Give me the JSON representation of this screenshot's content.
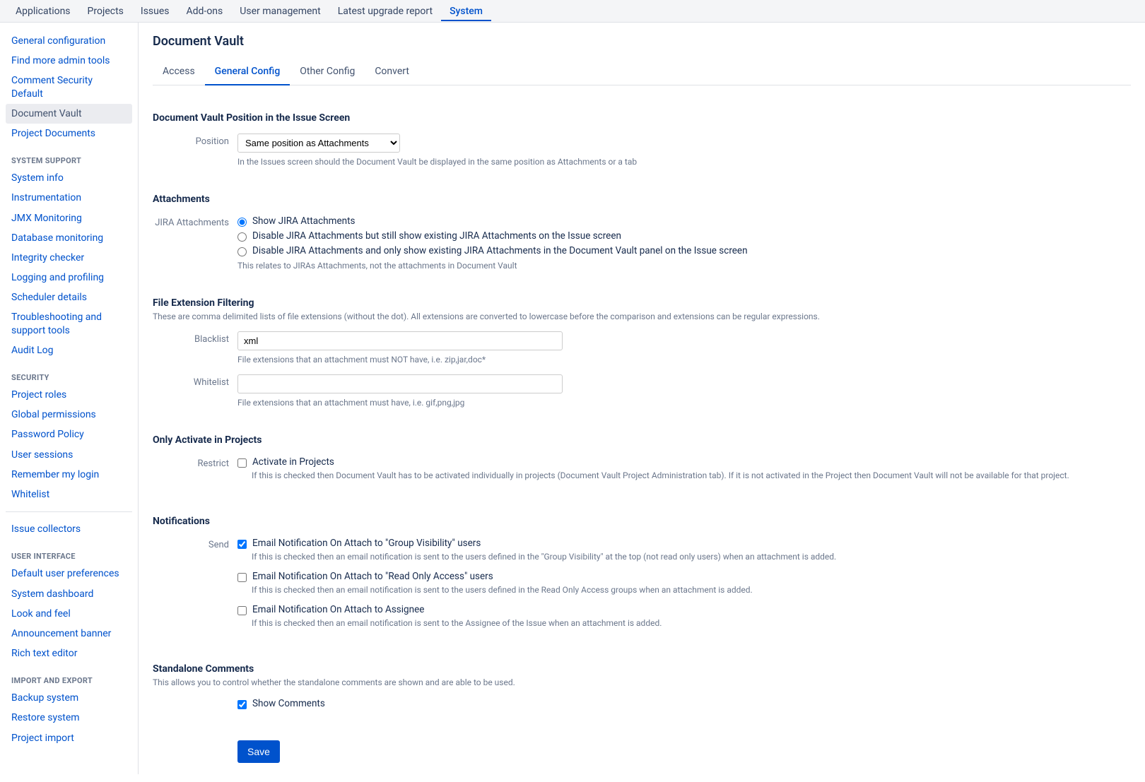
{
  "topnav": [
    {
      "label": "Applications",
      "active": false
    },
    {
      "label": "Projects",
      "active": false
    },
    {
      "label": "Issues",
      "active": false
    },
    {
      "label": "Add-ons",
      "active": false
    },
    {
      "label": "User management",
      "active": false
    },
    {
      "label": "Latest upgrade report",
      "active": false
    },
    {
      "label": "System",
      "active": true
    }
  ],
  "sidebar": {
    "group_top": [
      "General configuration",
      "Find more admin tools",
      "Comment Security Default",
      "Document Vault",
      "Project Documents"
    ],
    "selected": "Document Vault",
    "group_system_support_heading": "System Support",
    "group_system_support": [
      "System info",
      "Instrumentation",
      "JMX Monitoring",
      "Database monitoring",
      "Integrity checker",
      "Logging and profiling",
      "Scheduler details",
      "Troubleshooting and support tools",
      "Audit Log"
    ],
    "group_security_heading": "Security",
    "group_security": [
      "Project roles",
      "Global permissions",
      "Password Policy",
      "User sessions",
      "Remember my login",
      "Whitelist"
    ],
    "group_issue_collectors": [
      "Issue collectors"
    ],
    "group_ui_heading": "User Interface",
    "group_ui": [
      "Default user preferences",
      "System dashboard",
      "Look and feel",
      "Announcement banner",
      "Rich text editor"
    ],
    "group_import_heading": "Import and Export",
    "group_import": [
      "Backup system",
      "Restore system",
      "Project import"
    ]
  },
  "page": {
    "title": "Document Vault",
    "tabs": [
      "Access",
      "General Config",
      "Other Config",
      "Convert"
    ],
    "active_tab": "General Config"
  },
  "position_section": {
    "title": "Document Vault Position in the Issue Screen",
    "label": "Position",
    "selected": "Same position as Attachments",
    "help": "In the Issues screen should the Document Vault be displayed in the same position as Attachments or a tab"
  },
  "attachments_section": {
    "title": "Attachments",
    "label": "JIRA Attachments",
    "options": [
      "Show JIRA Attachments",
      "Disable JIRA Attachments but still show existing JIRA Attachments on the Issue screen",
      "Disable JIRA Attachments and only show existing JIRA Attachments in the Document Vault panel on the Issue screen"
    ],
    "selected_index": 0,
    "help": "This relates to JIRAs Attachments, not the attachments in Document Vault"
  },
  "filter_section": {
    "title": "File Extension Filtering",
    "desc": "These are comma delimited lists of file extensions (without the dot). All extensions are converted to lowercase before the comparison and extensions can be regular expressions.",
    "blacklist_label": "Blacklist",
    "blacklist_value": "xml",
    "blacklist_help": "File extensions that an attachment must NOT have, i.e. zip,jar,doc*",
    "whitelist_label": "Whitelist",
    "whitelist_value": "",
    "whitelist_help": "File extensions that an attachment must have, i.e. gif,png,jpg"
  },
  "activate_section": {
    "title": "Only Activate in Projects",
    "label": "Restrict",
    "option": "Activate in Projects",
    "checked": false,
    "help": "If this is checked then Document Vault has to be activated individually in projects (Document Vault Project Administration tab). If it is not activated in the Project then Document Vault will not be available for that project."
  },
  "notifications_section": {
    "title": "Notifications",
    "label": "Send",
    "options": [
      {
        "label": "Email Notification On Attach to \"Group Visibility\" users",
        "checked": true,
        "help": "If this is checked then an email notification is sent to the users defined in the \"Group Visibility\" at the top (not read only users) when an attachment is added."
      },
      {
        "label": "Email Notification On Attach to \"Read Only Access\" users",
        "checked": false,
        "help": "If this is checked then an email notification is sent to the users defined in the Read Only Access groups when an attachment is added."
      },
      {
        "label": "Email Notification On Attach to Assignee",
        "checked": false,
        "help": "If this is checked then an email notification is sent to the Assignee of the Issue when an attachment is added."
      }
    ]
  },
  "comments_section": {
    "title": "Standalone Comments",
    "desc": "This allows you to control whether the standalone comments are shown and are able to be used.",
    "option": "Show Comments",
    "checked": true
  },
  "save_label": "Save"
}
